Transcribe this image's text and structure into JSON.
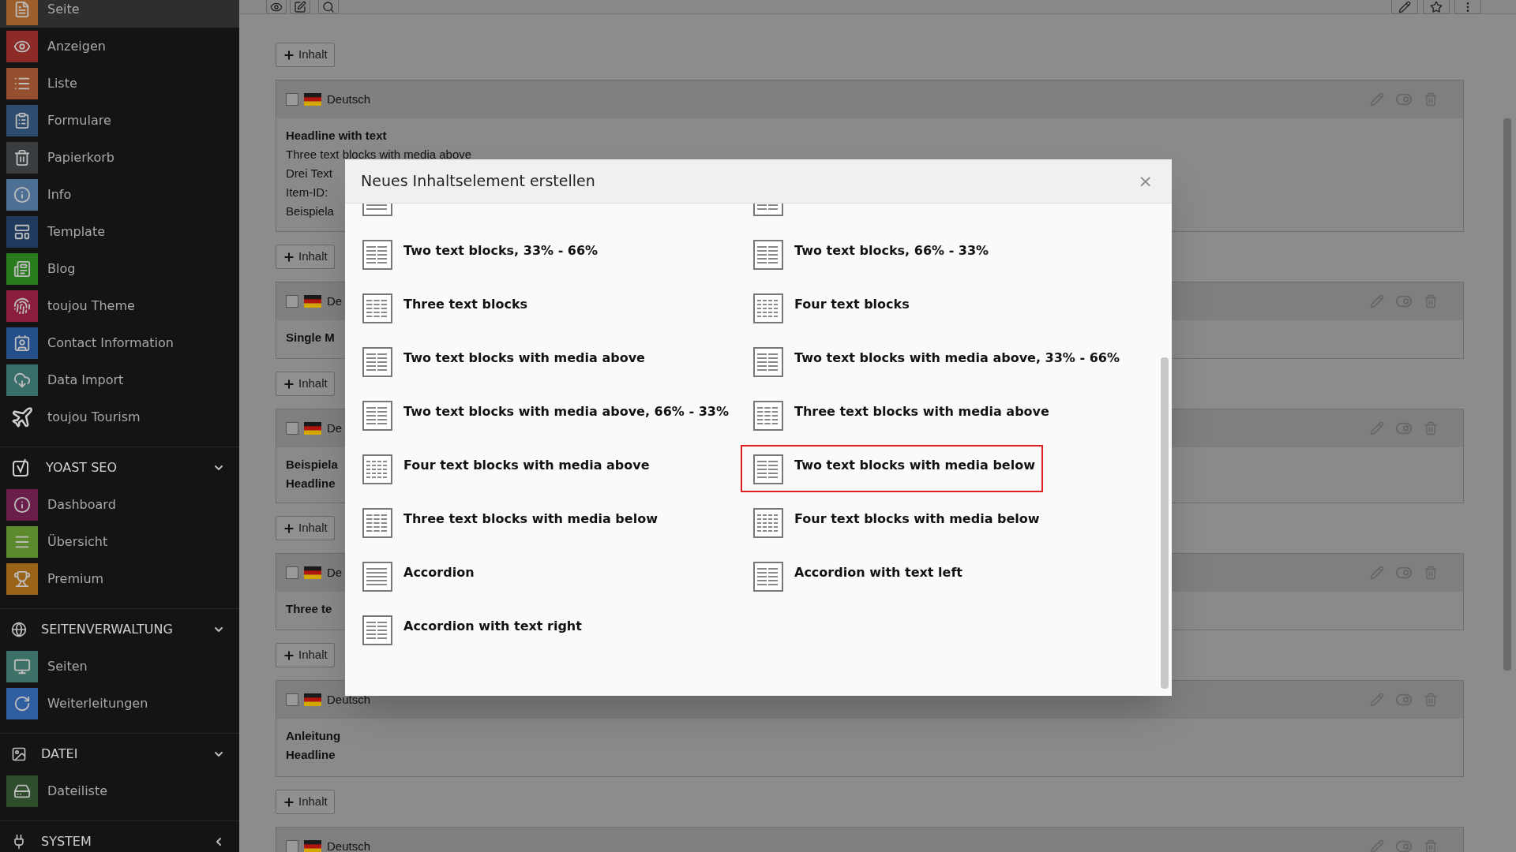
{
  "sidebar": {
    "items": [
      {
        "label": "Seite",
        "selected": true,
        "color": "#9c5f2c"
      },
      {
        "label": "Anzeigen",
        "selected": false,
        "color": "#8c2a25"
      },
      {
        "label": "Liste",
        "selected": false,
        "color": "#96502f"
      },
      {
        "label": "Formulare",
        "selected": false,
        "color": "#2c4d6e"
      },
      {
        "label": "Papierkorb",
        "selected": false,
        "color": "#3a3d3f"
      },
      {
        "label": "Info",
        "selected": false,
        "color": "#4d6f94"
      },
      {
        "label": "Template",
        "selected": false,
        "color": "#1f3a5c"
      },
      {
        "label": "Blog",
        "selected": false,
        "color": "#2a7a1e"
      },
      {
        "label": "toujou Theme",
        "selected": false,
        "color": "#8a1e3c"
      },
      {
        "label": "Contact Information",
        "selected": false,
        "color": "#244f8a"
      },
      {
        "label": "Data Import",
        "selected": false,
        "color": "#3a6e6a"
      },
      {
        "label": "toujou Tourism",
        "selected": false
      }
    ],
    "sections": [
      {
        "title": "YOAST SEO",
        "expanded": true,
        "items": [
          {
            "label": "Dashboard",
            "selected": false,
            "color": "#6a1e4a"
          },
          {
            "label": "Übersicht",
            "selected": false,
            "color": "#5e8a2e"
          },
          {
            "label": "Premium",
            "selected": false,
            "color": "#9a6418"
          }
        ]
      },
      {
        "title": "SEITENVERWALTUNG",
        "expanded": true,
        "items": [
          {
            "label": "Seiten",
            "selected": false,
            "color": "#3d7066"
          },
          {
            "label": "Weiterleitungen",
            "selected": false,
            "color": "#2f5ea0"
          }
        ]
      },
      {
        "title": "DATEI",
        "expanded": true,
        "items": [
          {
            "label": "Dateiliste",
            "selected": false,
            "color": "#2e4d2a"
          }
        ]
      },
      {
        "title": "SYSTEM",
        "expanded": false
      }
    ]
  },
  "content": {
    "cards": [
      {
        "add_button": "Inhalt",
        "language": "Deutsch",
        "lines": [
          {
            "text": "Headline with text",
            "bold": true
          },
          {
            "text": "Three text blocks with media above",
            "bold": false
          },
          {
            "text": "Drei Text",
            "bold": false
          },
          {
            "text": "Item-ID:",
            "bold": false
          },
          {
            "text": "Beispiela",
            "bold": false
          }
        ]
      },
      {
        "add_button": "Inhalt",
        "language": "De",
        "lines": [
          {
            "text": "Single M",
            "bold": true
          }
        ]
      },
      {
        "add_button": "Inhalt",
        "language": "De",
        "lines": [
          {
            "text": "Beispiela",
            "bold": true
          },
          {
            "text": "Headline",
            "bold": true
          }
        ]
      },
      {
        "add_button": "Inhalt",
        "language": "De",
        "lines": [
          {
            "text": "Three te",
            "bold": true
          }
        ]
      },
      {
        "add_button": "Inhalt",
        "language": "Deutsch",
        "lines": [
          {
            "text": "Anleitung",
            "bold": true
          },
          {
            "text": "Headline",
            "bold": true
          }
        ]
      },
      {
        "add_button": "Inhalt",
        "language": "Deutsch"
      }
    ]
  },
  "modal": {
    "title": "Neues Inhaltselement erstellen",
    "close": "×",
    "items": [
      {
        "label": "Two text blocks, 33% - 66%",
        "selected": false
      },
      {
        "label": "Two text blocks, 66% - 33%",
        "selected": false
      },
      {
        "label": "Three text blocks",
        "selected": false
      },
      {
        "label": "Four text blocks",
        "selected": false
      },
      {
        "label": "Two text blocks with media above",
        "selected": false
      },
      {
        "label": "Two text blocks with media above, 33% - 66%",
        "selected": false
      },
      {
        "label": "Two text blocks with media above, 66% - 33%",
        "selected": false
      },
      {
        "label": "Three text blocks with media above",
        "selected": false
      },
      {
        "label": "Four text blocks with media above",
        "selected": false
      },
      {
        "label": "Two text blocks with media below",
        "selected": true
      },
      {
        "label": "Three text blocks with media below",
        "selected": false
      },
      {
        "label": "Four text blocks with media below",
        "selected": false
      },
      {
        "label": "Accordion",
        "selected": false
      },
      {
        "label": "Accordion with text left",
        "selected": false
      },
      {
        "label": "Accordion with text right",
        "selected": false
      }
    ]
  }
}
